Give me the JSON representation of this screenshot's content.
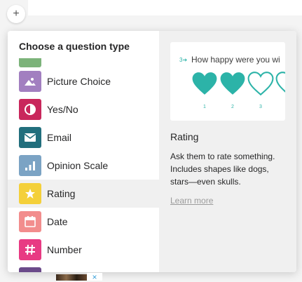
{
  "toolbar": {
    "add_label": "+"
  },
  "popup": {
    "title": "Choose a question type",
    "items": [
      {
        "label": "Picture Choice",
        "icon": "image-icon",
        "color": "#a27fc0",
        "selected": false
      },
      {
        "label": "Yes/No",
        "icon": "contrast-circle-icon",
        "color": "#c9275c",
        "selected": false
      },
      {
        "label": "Email",
        "icon": "envelope-icon",
        "color": "#226f7d",
        "selected": false
      },
      {
        "label": "Opinion Scale",
        "icon": "bar-chart-icon",
        "color": "#7ba3c4",
        "selected": false
      },
      {
        "label": "Rating",
        "icon": "star-icon",
        "color": "#f4d03a",
        "selected": true
      },
      {
        "label": "Date",
        "icon": "calendar-icon",
        "color": "#f28d8d",
        "selected": false
      },
      {
        "label": "Number",
        "icon": "hash-icon",
        "color": "#e83a83",
        "selected": false
      }
    ],
    "colors": {
      "partial_top": "#7cb37a",
      "partial_bottom": "#6b4a8a"
    }
  },
  "preview": {
    "question_number": "3",
    "question_text": "How happy were you wi",
    "hearts": [
      {
        "number": "1",
        "filled": true
      },
      {
        "number": "2",
        "filled": true
      },
      {
        "number": "3",
        "filled": false
      },
      {
        "number": "",
        "filled": false
      }
    ],
    "accent_color": "#2cb3a8",
    "title": "Rating",
    "description": "Ask them to rate something. Includes shapes like dogs, stars—even skulls.",
    "link": "Learn more"
  },
  "bottom": {
    "close_label": "×"
  }
}
